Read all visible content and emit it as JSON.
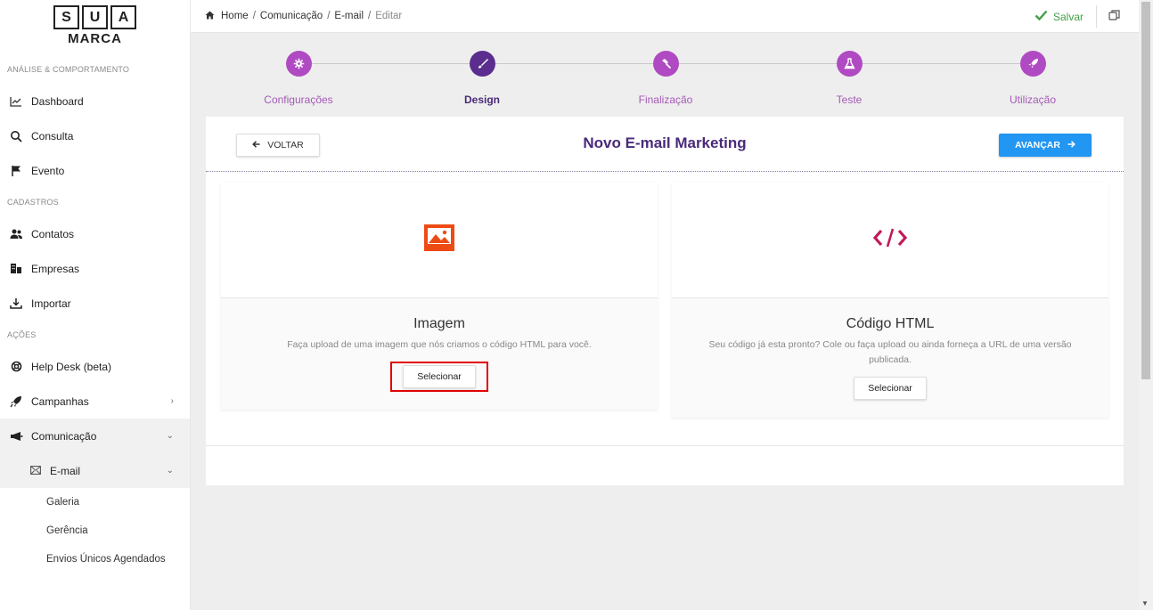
{
  "logo": {
    "letters": [
      "S",
      "U",
      "A"
    ],
    "word": "MARCA"
  },
  "sidebar": {
    "sections": [
      {
        "label": "ANÁLISE & COMPORTAMENTO"
      },
      {
        "label": "CADASTROS"
      },
      {
        "label": "AÇÕES"
      }
    ],
    "items": [
      {
        "label": "Dashboard",
        "icon": "chart-icon"
      },
      {
        "label": "Consulta",
        "icon": "search-icon"
      },
      {
        "label": "Evento",
        "icon": "flag-icon"
      },
      {
        "label": "Contatos",
        "icon": "contacts-icon"
      },
      {
        "label": "Empresas",
        "icon": "building-icon"
      },
      {
        "label": "Importar",
        "icon": "download-icon"
      },
      {
        "label": "Help Desk (beta)",
        "icon": "lifebuoy-icon"
      },
      {
        "label": "Campanhas",
        "icon": "rocket-icon",
        "chevron": "›"
      },
      {
        "label": "Comunicação",
        "icon": "megaphone-icon",
        "chevron": "⌄"
      }
    ],
    "sub_item": {
      "label": "E-mail",
      "icon": "envelope-icon",
      "chevron": "⌄"
    },
    "leaves": [
      "Galeria",
      "Gerência",
      "Envios Únicos Agendados"
    ]
  },
  "breadcrumb": {
    "items": [
      "Home",
      "Comunicação",
      "E-mail"
    ],
    "current": "Editar",
    "separator": "/"
  },
  "topbar": {
    "save_label": "Salvar",
    "save_color": "#43a047"
  },
  "stepper": {
    "steps": [
      {
        "label": "Configurações",
        "icon": "gear-icon"
      },
      {
        "label": "Design",
        "icon": "brush-icon"
      },
      {
        "label": "Finalização",
        "icon": "hammer-icon"
      },
      {
        "label": "Teste",
        "icon": "flask-icon"
      },
      {
        "label": "Utilização",
        "icon": "rocket-icon"
      }
    ],
    "active": "Design",
    "accent": "#b04ac2"
  },
  "card": {
    "title": "Novo E-mail Marketing",
    "back_label": "VOLTAR",
    "next_label": "AVANÇAR",
    "next_color": "#2196f3"
  },
  "options": [
    {
      "name": "Imagem",
      "description": "Faça upload de uma imagem que nós criamos o código HTML para você.",
      "button": "Selecionar",
      "icon": "image-icon"
    },
    {
      "name": "Código HTML",
      "description": "Seu código já esta pronto? Cole ou faça upload ou ainda forneça a URL de uma versão publicada.",
      "button": "Selecionar",
      "icon": "code-icon"
    }
  ]
}
